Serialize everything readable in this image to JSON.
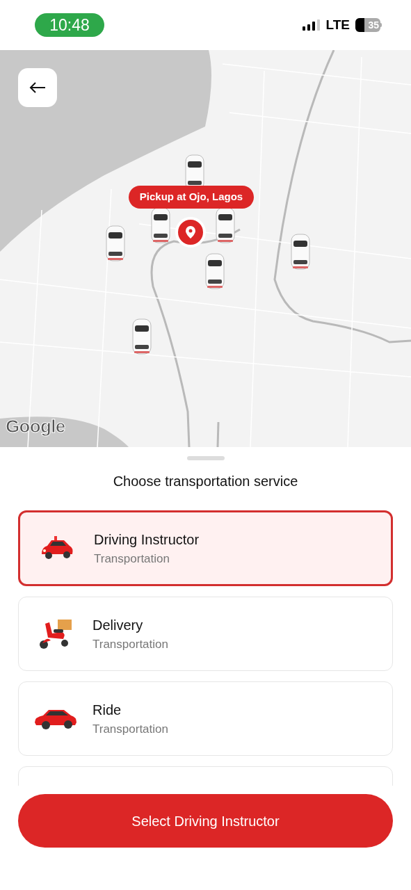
{
  "status_bar": {
    "time": "10:48",
    "network": "LTE",
    "battery": "35"
  },
  "map": {
    "pickup_label": "Pickup at Ojo, Lagos",
    "attribution": "Google"
  },
  "sheet": {
    "title": "Choose transportation service",
    "services": [
      {
        "kind": "instructor-car",
        "label": "Driving Instructor",
        "subtitle": "Transportation",
        "selected": true
      },
      {
        "kind": "scooter",
        "label": "Delivery",
        "subtitle": "Transportation",
        "selected": false
      },
      {
        "kind": "sedan",
        "label": "Ride",
        "subtitle": "Transportation",
        "selected": false
      }
    ],
    "action": "Select Driving Instructor"
  }
}
